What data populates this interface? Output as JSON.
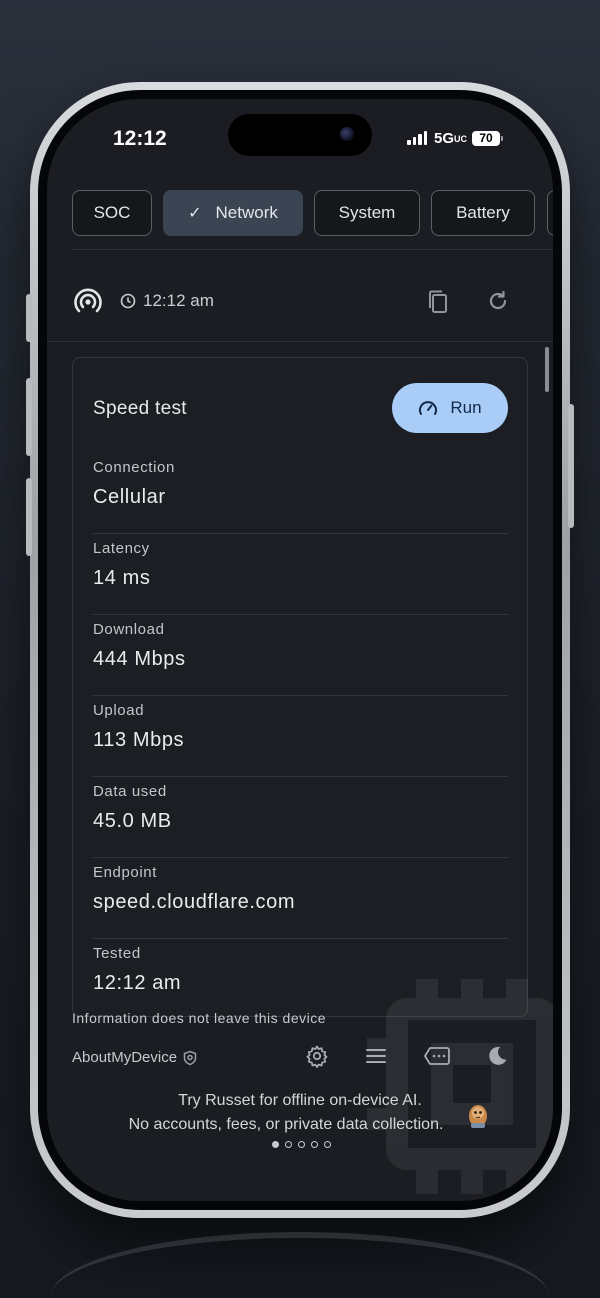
{
  "status_bar": {
    "time": "12:12",
    "network": "5G",
    "network_suffix": "UC",
    "battery": "70"
  },
  "tabs": [
    {
      "label": "SOC",
      "active": false
    },
    {
      "label": "Network",
      "active": true
    },
    {
      "label": "System",
      "active": false
    },
    {
      "label": "Battery",
      "active": false
    }
  ],
  "toolbar": {
    "timestamp": "12:12 am"
  },
  "speed_test": {
    "title": "Speed test",
    "run_label": "Run",
    "rows": [
      {
        "label": "Connection",
        "value": "Cellular"
      },
      {
        "label": "Latency",
        "value": "14 ms"
      },
      {
        "label": "Download",
        "value": "444 Mbps"
      },
      {
        "label": "Upload",
        "value": "113 Mbps"
      },
      {
        "label": "Data used",
        "value": "45.0 MB"
      },
      {
        "label": "Endpoint",
        "value": "speed.cloudflare.com"
      },
      {
        "label": "Tested",
        "value": "12:12 am"
      }
    ]
  },
  "footer": {
    "privacy_note": "Information does not leave this device",
    "brand": "AboutMyDevice",
    "promo_line1": "Try Russet for offline on-device AI.",
    "promo_line2": "No accounts, fees, or private data collection.",
    "pager_count": 5,
    "pager_active": 0
  },
  "icons": {
    "signal_strength": "signal-bars-icon",
    "connection_type": "wireless-signal-icon",
    "time": "clock-icon",
    "copy": "copy-icon",
    "refresh": "refresh-icon",
    "run": "speedometer-icon",
    "brand_badge": "shield-icon",
    "settings": "gear-icon",
    "menu": "menu-icon",
    "message": "message-dots-icon",
    "theme": "moon-icon"
  },
  "colors": {
    "accent_button": "#a9cdf6",
    "active_tab": "#3a4452",
    "screen_bg": "#1b1d22"
  }
}
